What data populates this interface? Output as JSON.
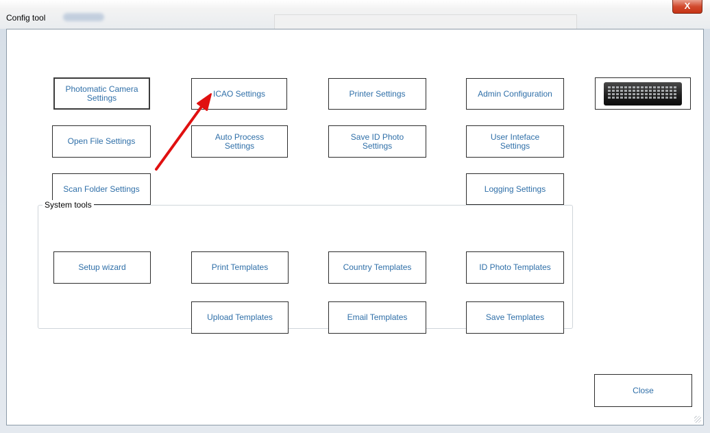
{
  "window": {
    "title": "Config tool",
    "close_glyph": "X"
  },
  "settings_buttons": {
    "photomatic_camera": "Photomatic Camera\nSettings",
    "icao": "ICAO Settings",
    "printer": "Printer Settings",
    "admin_configuration": "Admin Configuration",
    "open_file": "Open File Settings",
    "auto_process": "Auto Process\nSettings",
    "save_id_photo": "Save ID Photo\nSettings",
    "user_interface": "User Inteface\nSettings",
    "scan_folder": "Scan Folder Settings",
    "logging": "Logging Settings"
  },
  "system_tools": {
    "label": "System tools",
    "setup_wizard": "Setup wizard",
    "print_templates": "Print Templates",
    "country_templates": "Country Templates",
    "id_photo_templates": "ID Photo Templates",
    "upload_templates": "Upload Templates",
    "email_templates": "Email Templates",
    "save_templates": "Save Templates"
  },
  "footer": {
    "close": "Close"
  },
  "icons": {
    "keyboard": "keyboard-icon",
    "annotation_arrow": "red-arrow-icon"
  },
  "colors": {
    "button_text": "#2f6fa8",
    "arrow": "#e01010",
    "close_button": "#d24a2e"
  }
}
